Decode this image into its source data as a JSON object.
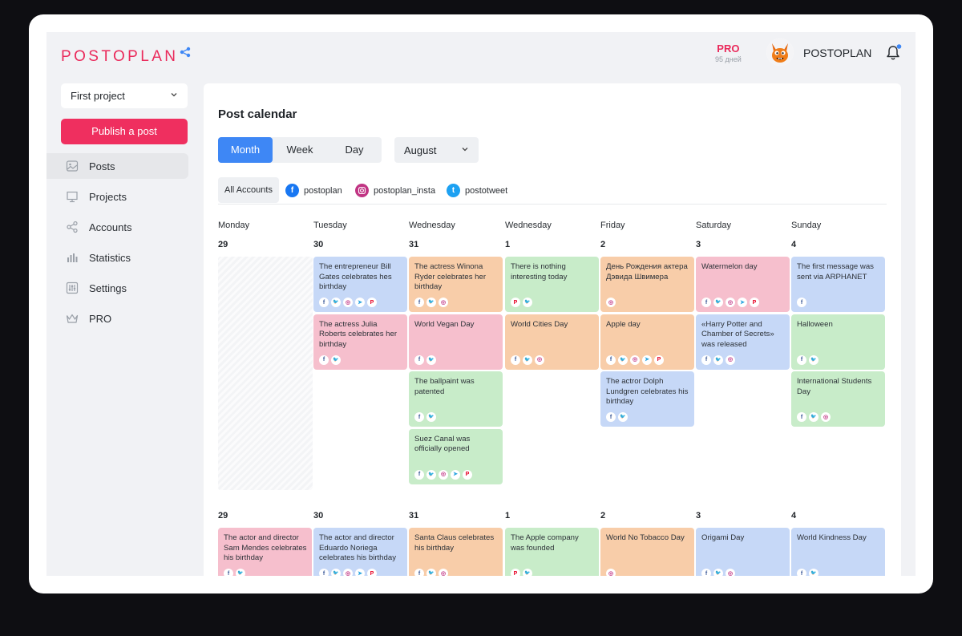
{
  "app": {
    "logo": "POSTOPLAN",
    "pro": {
      "label": "PRO",
      "days": "95 дней"
    },
    "user_name": "POSTOPLAN"
  },
  "sidebar": {
    "project": "First project",
    "publish_label": "Publish a post",
    "items": [
      {
        "label": "Posts",
        "icon": "posts-icon",
        "active": true
      },
      {
        "label": "Projects",
        "icon": "projects-icon",
        "active": false
      },
      {
        "label": "Accounts",
        "icon": "share-icon",
        "active": false
      },
      {
        "label": "Statistics",
        "icon": "statistics-icon",
        "active": false
      },
      {
        "label": "Settings",
        "icon": "settings-icon",
        "active": false
      },
      {
        "label": "PRO",
        "icon": "crown-icon",
        "active": false
      }
    ]
  },
  "main": {
    "title": "Post calendar",
    "views": [
      {
        "label": "Month",
        "active": true
      },
      {
        "label": "Week",
        "active": false
      },
      {
        "label": "Day",
        "active": false
      }
    ],
    "month": "August",
    "accounts_all": "All Accounts",
    "accounts": [
      {
        "name": "postoplan",
        "network": "facebook"
      },
      {
        "name": "postoplan_insta",
        "network": "instagram"
      },
      {
        "name": "postotweet",
        "network": "twitter"
      }
    ],
    "day_headers": [
      "Monday",
      "Tuesday",
      "Wednesday",
      "Wednesday",
      "Friday",
      "Saturday",
      "Sunday"
    ],
    "weeks": [
      {
        "dates": [
          "29",
          "30",
          "31",
          "1",
          "2",
          "3",
          "4"
        ],
        "columns": [
          [],
          [
            {
              "text": "The entrepreneur Bill Gates celebrates hes birthday",
              "color": "blue",
              "networks": [
                "fb",
                "tw",
                "ig",
                "tg",
                "pi"
              ]
            },
            {
              "text": "The actress Julia Roberts celebrates her birthday",
              "color": "pink",
              "networks": [
                "fb",
                "tw"
              ]
            }
          ],
          [
            {
              "text": "The actress Winona Ryder celebrates her birthday",
              "color": "orange",
              "networks": [
                "fb",
                "tw",
                "ig"
              ]
            },
            {
              "text": "World Vegan Day",
              "color": "pink",
              "networks": [
                "fb",
                "tw"
              ]
            },
            {
              "text": "The ballpaint was patented",
              "color": "green",
              "networks": [
                "fb",
                "tw"
              ]
            },
            {
              "text": "Suez Canal was officially opened",
              "color": "green",
              "networks": [
                "fb",
                "tw",
                "ig",
                "tg",
                "pi"
              ]
            }
          ],
          [
            {
              "text": "There is nothing interesting today",
              "color": "green",
              "networks": [
                "pi",
                "tw"
              ]
            },
            {
              "text": "World Cities Day",
              "color": "orange",
              "networks": [
                "fb",
                "tw",
                "ig"
              ]
            }
          ],
          [
            {
              "text": "День Рождения актера Дэвида Швимера",
              "color": "orange",
              "networks": [
                "ig"
              ]
            },
            {
              "text": "Apple day",
              "color": "orange",
              "networks": [
                "fb",
                "tw",
                "ig",
                "tg",
                "pi"
              ]
            },
            {
              "text": "The actror Dolph Lundgren celebrates his birthday",
              "color": "blue",
              "networks": [
                "fb",
                "tw"
              ]
            }
          ],
          [
            {
              "text": "Watermelon day",
              "color": "pink",
              "networks": [
                "fb",
                "tw",
                "ig",
                "tg",
                "pi"
              ]
            },
            {
              "text": "«Harry Potter and Chamber of Secrets» was released",
              "color": "blue",
              "networks": [
                "fb",
                "tw",
                "ig"
              ]
            }
          ],
          [
            {
              "text": "The first message was sent via ARPHANET",
              "color": "blue",
              "networks": [
                "fb"
              ]
            },
            {
              "text": "Halloween",
              "color": "green",
              "networks": [
                "fb",
                "tw"
              ]
            },
            {
              "text": "International Students Day",
              "color": "green",
              "networks": [
                "fb",
                "tw",
                "ig"
              ]
            }
          ]
        ]
      },
      {
        "dates": [
          "29",
          "30",
          "31",
          "1",
          "2",
          "3",
          "4"
        ],
        "columns": [
          [
            {
              "text": "The actor and director Sam Mendes celebrates his birthday",
              "color": "pink",
              "networks": [
                "fb",
                "tw"
              ]
            }
          ],
          [
            {
              "text": "The actor and director Eduardo Noriega celebrates his birthday",
              "color": "blue",
              "networks": [
                "fb",
                "tw",
                "ig",
                "tg",
                "pi"
              ]
            }
          ],
          [
            {
              "text": "Santa Claus celebrates his birthday",
              "color": "orange",
              "networks": [
                "fb",
                "tw",
                "ig"
              ]
            }
          ],
          [
            {
              "text": "The Apple company was founded",
              "color": "green",
              "networks": [
                "pi",
                "tw"
              ]
            }
          ],
          [
            {
              "text": "World No Tobacco Day",
              "color": "orange",
              "networks": [
                "ig"
              ]
            }
          ],
          [
            {
              "text": "Origami Day",
              "color": "blue",
              "networks": [
                "fb",
                "tw",
                "ig"
              ]
            }
          ],
          [
            {
              "text": "World Kindness Day",
              "color": "blue",
              "networks": [
                "fb",
                "tw"
              ]
            }
          ]
        ]
      }
    ]
  },
  "colors": {
    "brand": "#ea2a5b",
    "publish": "#ef2f5f",
    "accent": "#3e87f5",
    "card_blue": "#c6d8f7",
    "card_pink": "#f6bfcd",
    "card_orange": "#f8cda9",
    "card_green": "#c8ecc9"
  }
}
